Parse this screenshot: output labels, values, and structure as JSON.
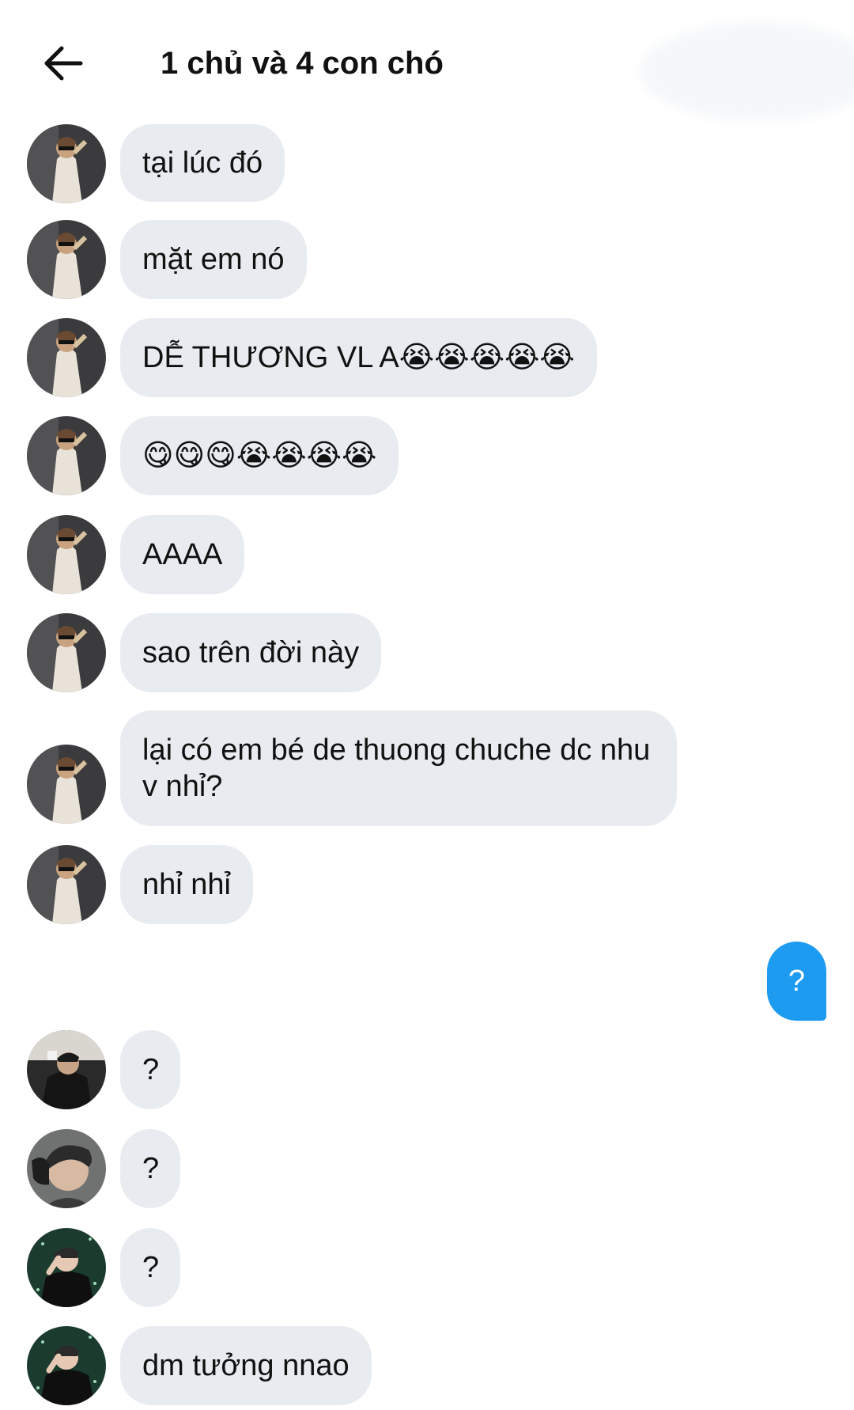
{
  "header": {
    "title": "1 chủ và 4 con chó",
    "back_icon": "arrow-left-icon"
  },
  "messages": [
    {
      "sender": "user1",
      "text": "tại lúc đó"
    },
    {
      "sender": "user1",
      "text": "mặt em nó"
    },
    {
      "sender": "user1",
      "text": "DỄ THƯƠNG VL A😭😭😭😭😭"
    },
    {
      "sender": "user1",
      "text": "😋😋😋😭😭😭😭"
    },
    {
      "sender": "user1",
      "text": "AAAA"
    },
    {
      "sender": "user1",
      "text": "sao trên đời này"
    },
    {
      "sender": "user1",
      "text": "lại có em bé de thuong chuche dc nhu v nhỉ?"
    },
    {
      "sender": "user1",
      "text": "nhỉ nhỉ"
    },
    {
      "sender": "me",
      "text": "?"
    },
    {
      "sender": "user2",
      "text": "?"
    },
    {
      "sender": "user3",
      "text": "?"
    },
    {
      "sender": "user4",
      "text": "?"
    },
    {
      "sender": "user4",
      "text": "dm tưởng nnao"
    }
  ],
  "colors": {
    "received_bubble": "#e8ecf0",
    "sent_bubble": "#1d9bf0",
    "text": "#111111"
  }
}
